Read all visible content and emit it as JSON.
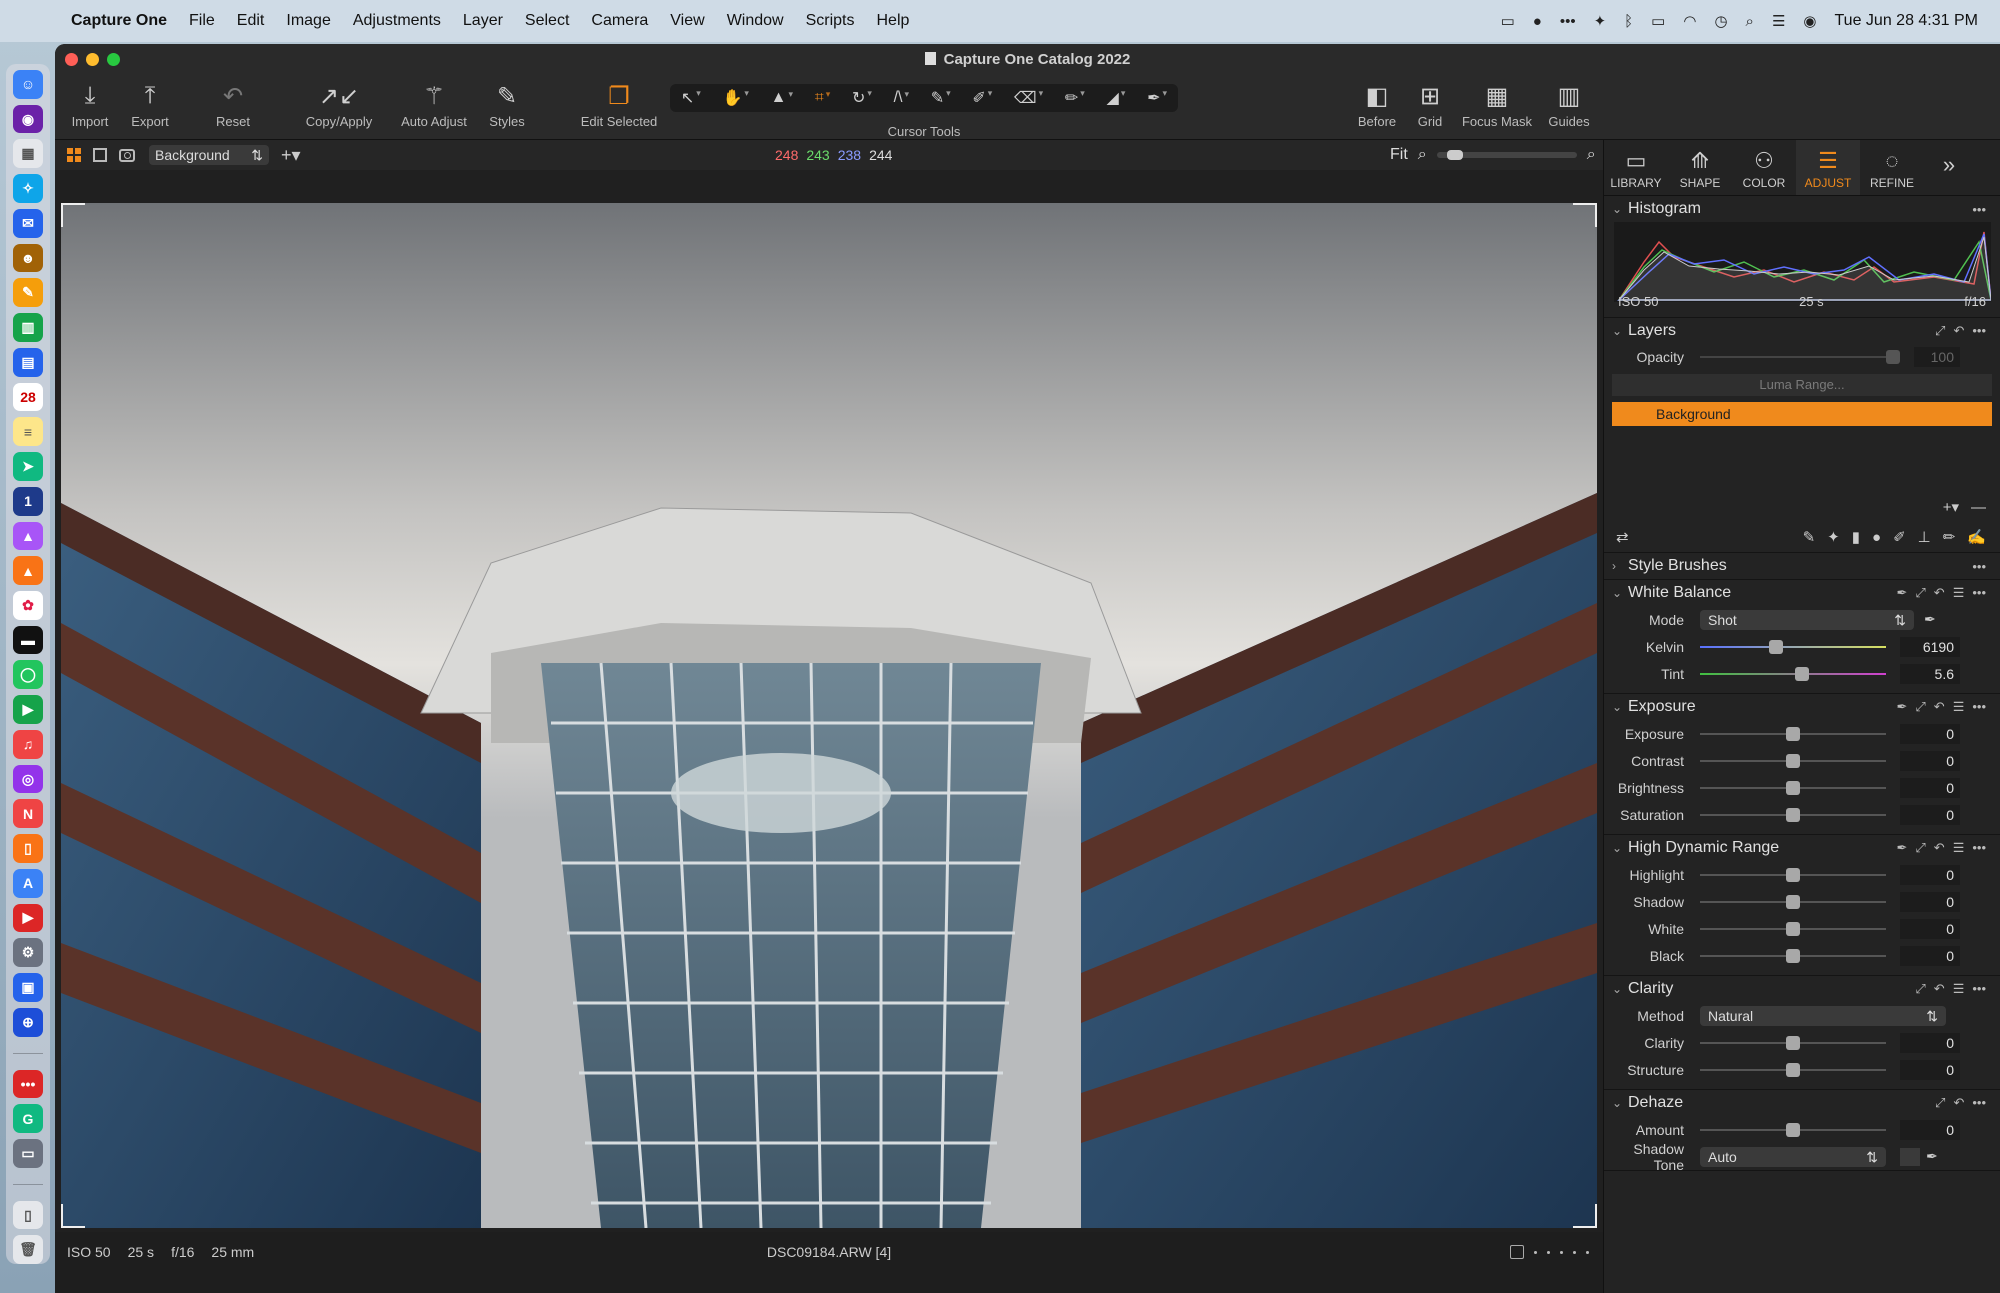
{
  "menubar": {
    "app_name": "Capture One",
    "items": [
      "File",
      "Edit",
      "Image",
      "Adjustments",
      "Layer",
      "Select",
      "Camera",
      "View",
      "Window",
      "Scripts",
      "Help"
    ],
    "clock": "Tue Jun 28  4:31 PM"
  },
  "window": {
    "title": "Capture One Catalog 2022"
  },
  "toolbar": {
    "import": "Import",
    "export": "Export",
    "reset": "Reset",
    "copy_apply": "Copy/Apply",
    "auto_adjust": "Auto Adjust",
    "styles": "Styles",
    "edit_selected": "Edit Selected",
    "cursor_tools": "Cursor Tools",
    "before": "Before",
    "grid": "Grid",
    "focus_mask": "Focus Mask",
    "guides": "Guides"
  },
  "viewer": {
    "layer_select": "Background",
    "rgb": {
      "r": "248",
      "g": "243",
      "b": "238",
      "l": "244"
    },
    "zoom_label": "Fit"
  },
  "info": {
    "iso": "ISO 50",
    "shutter": "25 s",
    "aperture": "f/16",
    "focal": "25 mm",
    "filename": "DSC09184.ARW [4]"
  },
  "panel": {
    "tabs": [
      "LIBRARY",
      "SHAPE",
      "COLOR",
      "ADJUST",
      "REFINE"
    ],
    "histogram": {
      "title": "Histogram",
      "iso": "ISO 50",
      "shutter": "25 s",
      "aperture": "f/16"
    },
    "layers": {
      "title": "Layers",
      "opacity_label": "Opacity",
      "opacity_value": "100",
      "luma": "Luma Range...",
      "background": "Background"
    },
    "style_brushes": "Style Brushes",
    "white_balance": {
      "title": "White Balance",
      "mode_label": "Mode",
      "mode_value": "Shot",
      "kelvin_label": "Kelvin",
      "kelvin_value": "6190",
      "tint_label": "Tint",
      "tint_value": "5.6"
    },
    "exposure": {
      "title": "Exposure",
      "rows": [
        {
          "label": "Exposure",
          "value": "0"
        },
        {
          "label": "Contrast",
          "value": "0"
        },
        {
          "label": "Brightness",
          "value": "0"
        },
        {
          "label": "Saturation",
          "value": "0"
        }
      ]
    },
    "hdr": {
      "title": "High Dynamic Range",
      "rows": [
        {
          "label": "Highlight",
          "value": "0"
        },
        {
          "label": "Shadow",
          "value": "0"
        },
        {
          "label": "White",
          "value": "0"
        },
        {
          "label": "Black",
          "value": "0"
        }
      ]
    },
    "clarity": {
      "title": "Clarity",
      "method_label": "Method",
      "method_value": "Natural",
      "rows": [
        {
          "label": "Clarity",
          "value": "0"
        },
        {
          "label": "Structure",
          "value": "0"
        }
      ]
    },
    "dehaze": {
      "title": "Dehaze",
      "amount_label": "Amount",
      "amount_value": "0",
      "shadow_label": "Shadow Tone",
      "shadow_value": "Auto"
    }
  },
  "colors": {
    "accent": "#f08a1c"
  }
}
